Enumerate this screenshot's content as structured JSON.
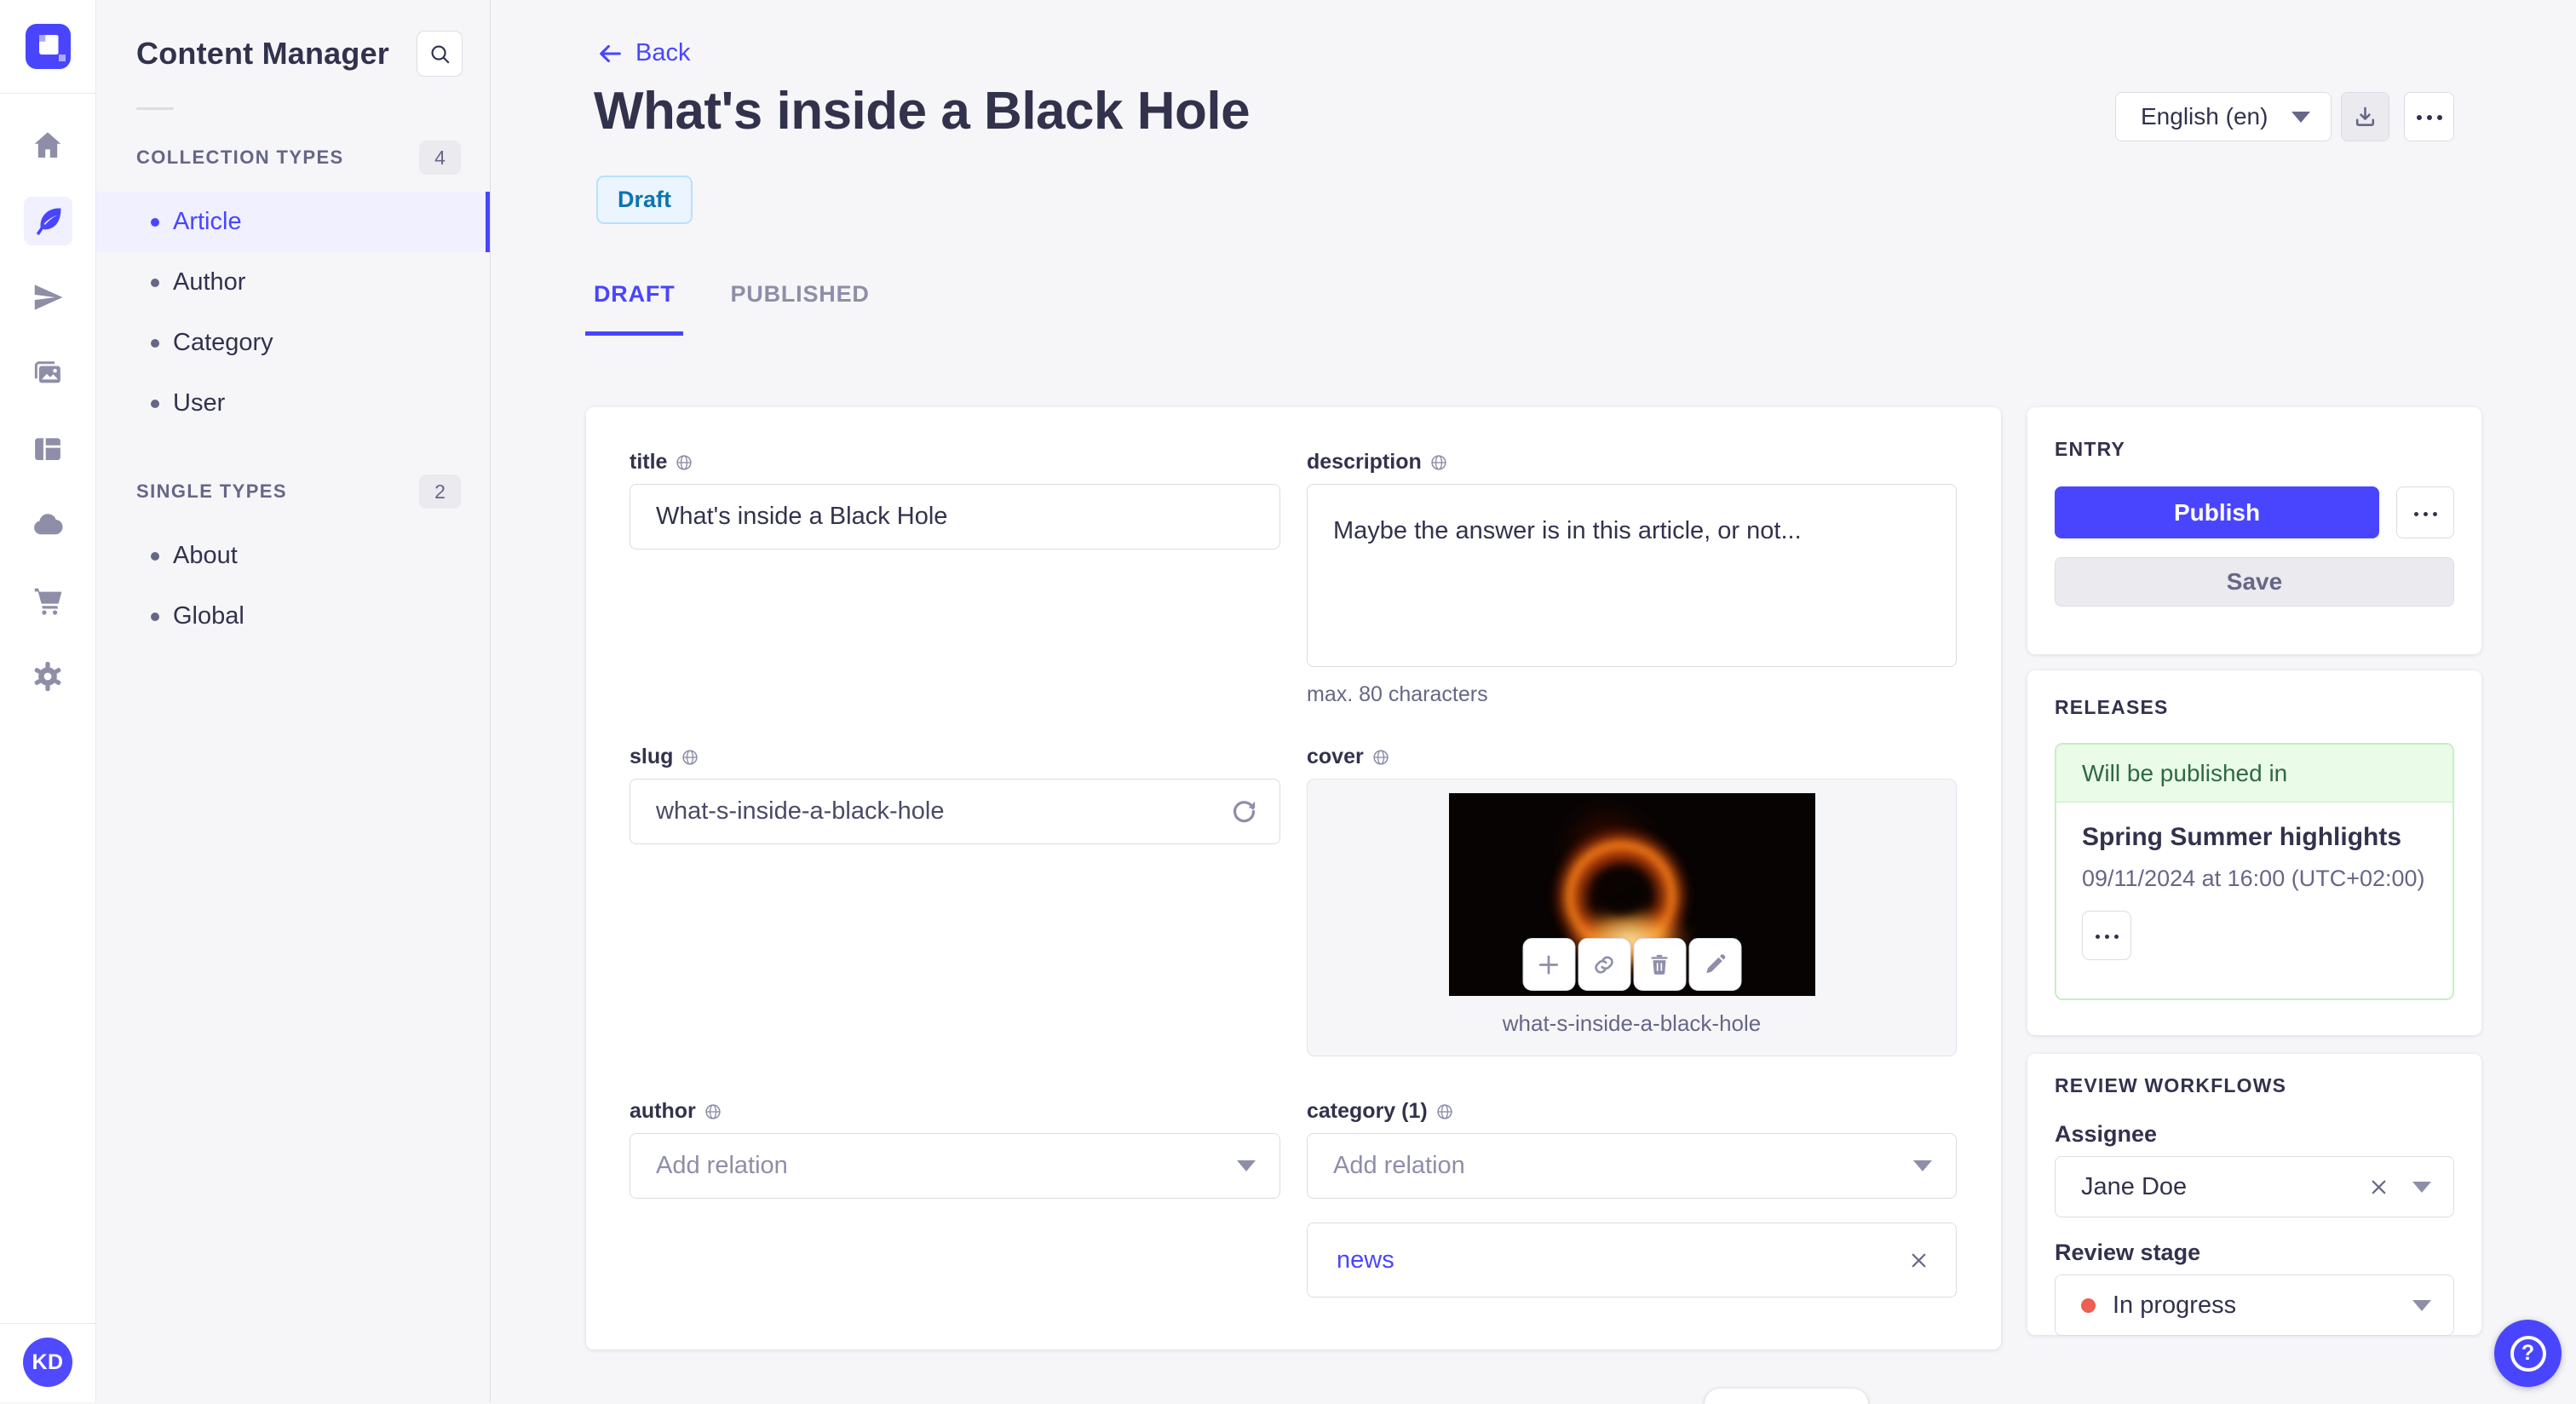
{
  "colors": {
    "primary": "#4945ff",
    "primary_light_bg": "#f0f0ff",
    "draft_text": "#0c75af",
    "draft_bg": "#eaf5ff",
    "success_text": "#2f6846",
    "success_bg": "#eafbe7",
    "danger_dot": "#ee5e52",
    "text": "#32324d",
    "muted": "#666687",
    "border": "#dcdce4",
    "page_bg": "#f6f6f9"
  },
  "nav": {
    "logo": "strapi-logo",
    "icons": [
      {
        "name": "home-icon",
        "active": false
      },
      {
        "name": "feather-content-icon",
        "active": true
      },
      {
        "name": "send-icon",
        "active": false
      },
      {
        "name": "media-library-icon",
        "active": false
      },
      {
        "name": "layout-builder-icon",
        "active": false
      },
      {
        "name": "cloud-icon",
        "active": false
      },
      {
        "name": "marketplace-cart-icon",
        "active": false
      },
      {
        "name": "settings-gear-icon",
        "active": false
      }
    ],
    "avatar_initials": "KD"
  },
  "subnav": {
    "title": "Content Manager",
    "search_icon": "search-icon",
    "sections": [
      {
        "label": "COLLECTION TYPES",
        "count": "4",
        "items": [
          {
            "label": "Article",
            "active": true
          },
          {
            "label": "Author",
            "active": false
          },
          {
            "label": "Category",
            "active": false
          },
          {
            "label": "User",
            "active": false
          }
        ]
      },
      {
        "label": "SINGLE TYPES",
        "count": "2",
        "items": [
          {
            "label": "About",
            "active": false
          },
          {
            "label": "Global",
            "active": false
          }
        ]
      }
    ]
  },
  "header": {
    "back_label": "Back",
    "title": "What's inside a Black Hole",
    "status_badge": "Draft",
    "locale_selected": "English (en)",
    "tabs": [
      {
        "label": "DRAFT",
        "active": true
      },
      {
        "label": "PUBLISHED",
        "active": false
      }
    ]
  },
  "form": {
    "title": {
      "label": "title",
      "value": "What's inside a Black Hole"
    },
    "description": {
      "label": "description",
      "value": "Maybe the answer is in this article, or not...",
      "hint": "max. 80 characters"
    },
    "slug": {
      "label": "slug",
      "value": "what-s-inside-a-black-hole",
      "regenerate_icon": "refresh-icon"
    },
    "cover": {
      "label": "cover",
      "caption": "what-s-inside-a-black-hole",
      "actions": [
        "add-icon",
        "link-icon",
        "trash-icon",
        "pencil-icon"
      ]
    },
    "author": {
      "label": "author",
      "placeholder": "Add relation"
    },
    "category": {
      "label": "category (1)",
      "placeholder": "Add relation",
      "relations": [
        {
          "name": "news"
        }
      ]
    }
  },
  "entry_panel": {
    "title": "ENTRY",
    "publish_label": "Publish",
    "save_label": "Save"
  },
  "releases_panel": {
    "title": "RELEASES",
    "status_text": "Will be published in",
    "release_name": "Spring Summer highlights",
    "release_date": "09/11/2024 at 16:00 (UTC+02:00)"
  },
  "review_panel": {
    "title": "REVIEW WORKFLOWS",
    "assignee_label": "Assignee",
    "assignee_value": "Jane Doe",
    "stage_label": "Review stage",
    "stage_value": "In progress"
  }
}
